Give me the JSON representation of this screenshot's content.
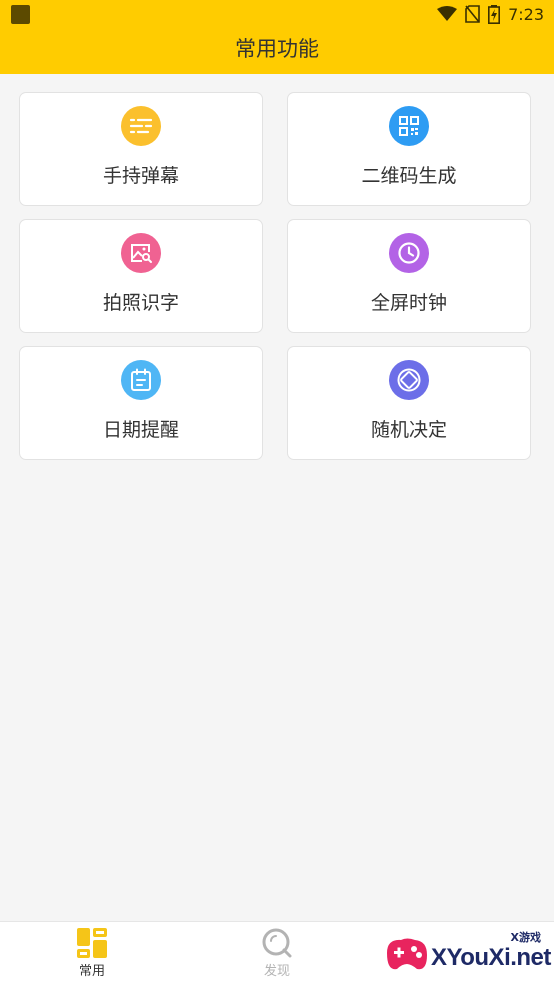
{
  "status_bar": {
    "time": "7:23",
    "icons": [
      "wifi-icon",
      "no-sim-icon",
      "battery-charging-icon"
    ]
  },
  "header": {
    "title": "常用功能",
    "background_color": "#ffcc00"
  },
  "features": [
    {
      "label": "手持弹幕",
      "icon": "text-lines-icon",
      "color": "#fbc02d"
    },
    {
      "label": "二维码生成",
      "icon": "qr-code-icon",
      "color": "#2e9cf3"
    },
    {
      "label": "拍照识字",
      "icon": "image-search-icon",
      "color": "#f06292"
    },
    {
      "label": "全屏时钟",
      "icon": "clock-icon",
      "color": "#b363e6"
    },
    {
      "label": "日期提醒",
      "icon": "calendar-icon",
      "color": "#4fb6f5"
    },
    {
      "label": "随机决定",
      "icon": "random-shapes-icon",
      "color": "#6c6ee8"
    }
  ],
  "tabbar": {
    "tabs": [
      {
        "label": "常用",
        "icon": "grid-icon",
        "active": true
      },
      {
        "label": "发现",
        "icon": "discover-icon",
        "active": false
      }
    ],
    "active_color": "#f5c518",
    "inactive_color": "#b3b3b3"
  },
  "watermark": {
    "text": "XYouXi.net",
    "small_text": "X游戏"
  }
}
